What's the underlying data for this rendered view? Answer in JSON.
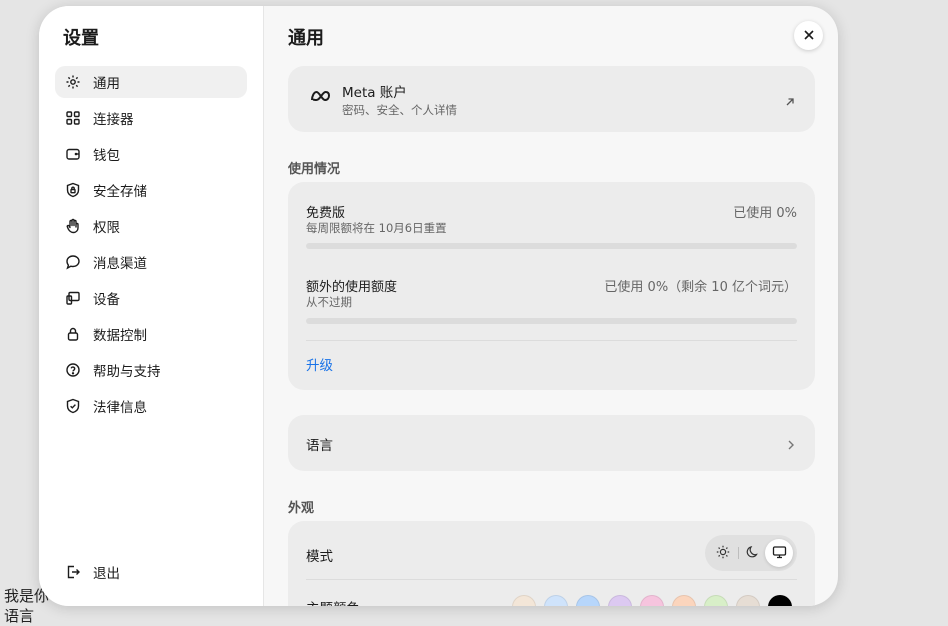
{
  "background": {
    "text_line1": "我是你",
    "text_line2": "语言"
  },
  "sidebar": {
    "title": "设置",
    "items": [
      {
        "label": "通用",
        "icon": "gear-icon",
        "active": true
      },
      {
        "label": "连接器",
        "icon": "grid-icon"
      },
      {
        "label": "钱包",
        "icon": "wallet-icon"
      },
      {
        "label": "安全存储",
        "icon": "shield-lock-icon"
      },
      {
        "label": "权限",
        "icon": "hand-icon"
      },
      {
        "label": "消息渠道",
        "icon": "chat-bubble-icon"
      },
      {
        "label": "设备",
        "icon": "devices-icon"
      },
      {
        "label": "数据控制",
        "icon": "lock-icon"
      },
      {
        "label": "帮助与支持",
        "icon": "help-circle-icon"
      },
      {
        "label": "法律信息",
        "icon": "shield-check-icon"
      }
    ],
    "logout_label": "退出"
  },
  "main": {
    "title": "通用",
    "meta_account": {
      "title": "Meta 账户",
      "subtitle": "密码、安全、个人详情"
    },
    "usage": {
      "section_title": "使用情况",
      "free_plan": {
        "title": "免费版",
        "subtitle": "每周限额将在 10月6日重置",
        "status": "已使用 0%",
        "percent": 0
      },
      "extra": {
        "title": "额外的使用额度",
        "subtitle": "从不过期",
        "status": "已使用 0%（剩余 10 亿个词元）",
        "percent": 0
      },
      "upgrade_label": "升级"
    },
    "language": {
      "label": "语言"
    },
    "appearance": {
      "section_title": "外观",
      "mode_label": "模式",
      "modes": [
        "sun-icon",
        "moon-icon",
        "monitor-icon"
      ],
      "selected_mode": "monitor-icon",
      "theme_label": "主题颜色",
      "theme_colors": [
        "#f3e6d8",
        "#cfe3fb",
        "#b7d6fb",
        "#dcc9f1",
        "#f6c4de",
        "#fbd5bd",
        "#d8efc8",
        "#e6ddd4",
        "#000000"
      ]
    }
  }
}
